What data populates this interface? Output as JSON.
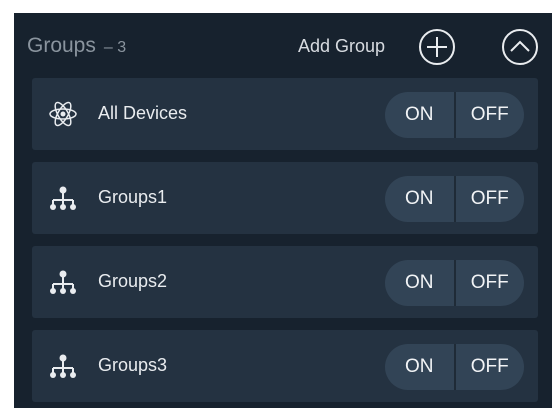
{
  "header": {
    "title": "Groups",
    "count": "– 3",
    "add_group_label": "Add Group",
    "add_icon": "plus-circle-icon",
    "collapse_icon": "chevron-up-circle-icon"
  },
  "colors": {
    "panel_bg": "#17222e",
    "row_bg": "#243241",
    "toggle_bg": "#324456",
    "text": "#e9ecef",
    "muted": "#8a949e"
  },
  "rows": [
    {
      "label": "All Devices",
      "icon": "atom-icon",
      "on_label": "ON",
      "off_label": "OFF"
    },
    {
      "label": "Groups1",
      "icon": "group-tree-icon",
      "on_label": "ON",
      "off_label": "OFF"
    },
    {
      "label": "Groups2",
      "icon": "group-tree-icon",
      "on_label": "ON",
      "off_label": "OFF"
    },
    {
      "label": "Groups3",
      "icon": "group-tree-icon",
      "on_label": "ON",
      "off_label": "OFF"
    }
  ]
}
